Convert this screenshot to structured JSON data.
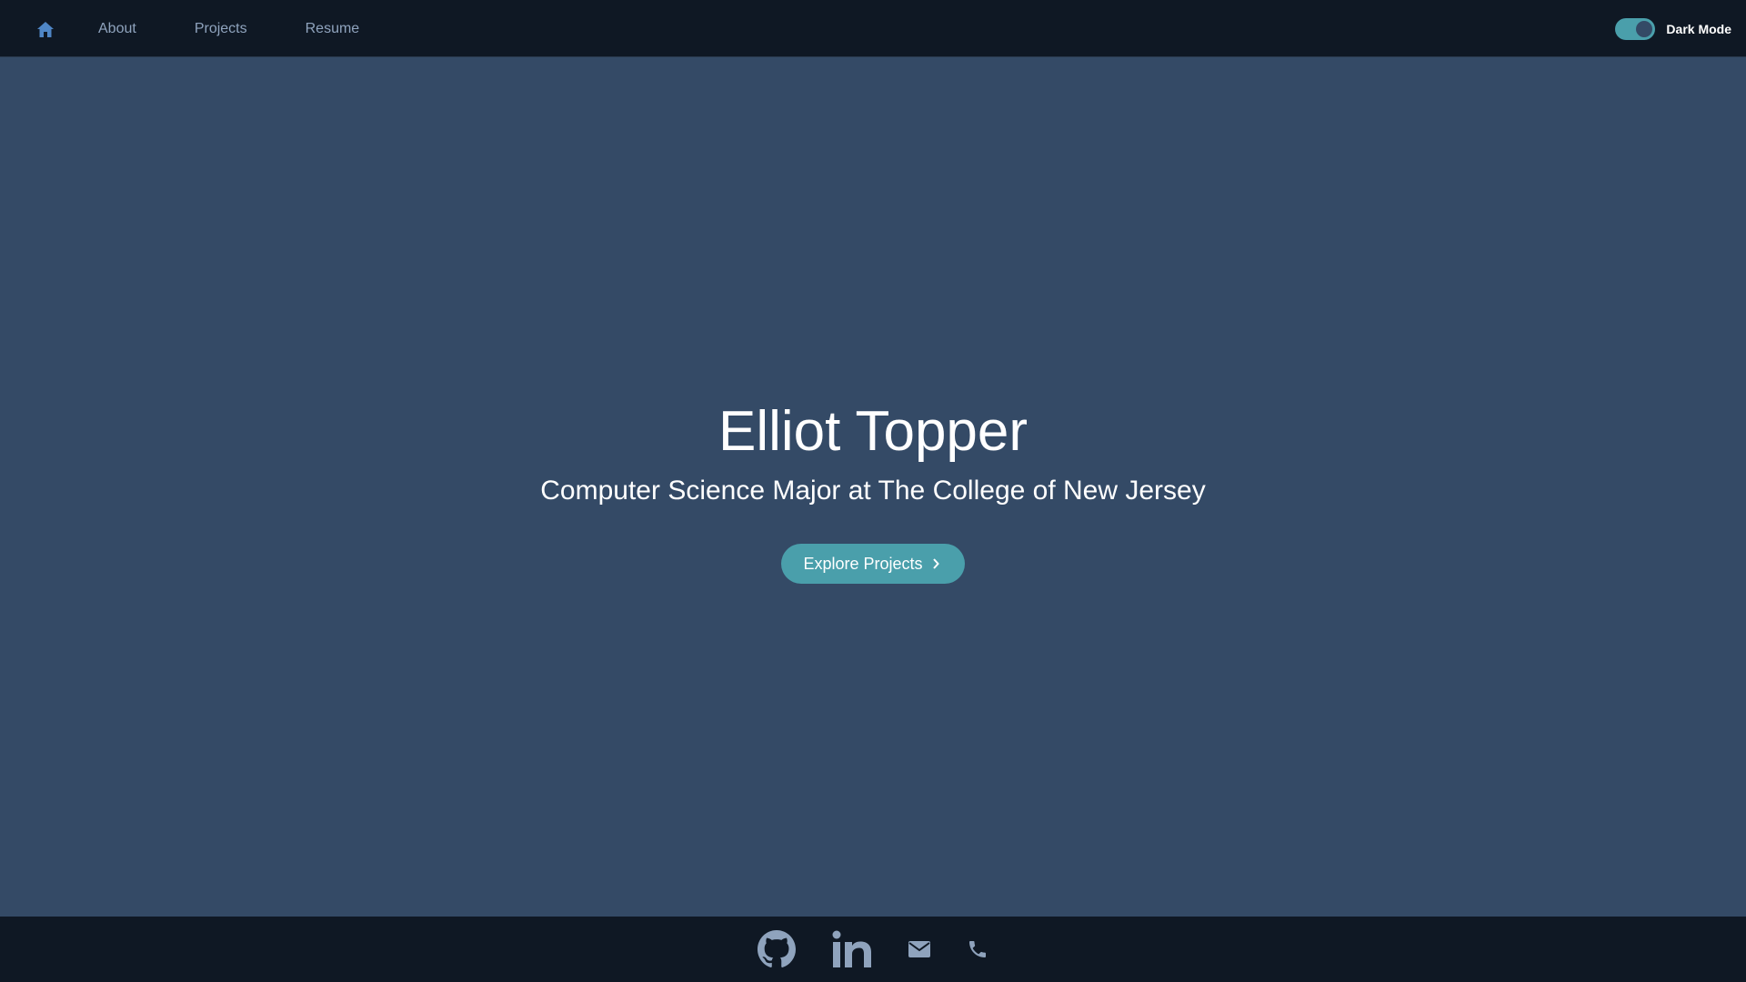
{
  "nav": {
    "home_icon": "home-icon",
    "links": [
      {
        "label": "About"
      },
      {
        "label": "Projects"
      },
      {
        "label": "Resume"
      }
    ]
  },
  "theme_toggle": {
    "label": "Dark Mode",
    "enabled": true
  },
  "hero": {
    "title": "Elliot Topper",
    "subtitle": "Computer Science Major at The College of New Jersey",
    "cta_label": "Explore Projects",
    "cta_icon": "chevron-right-icon"
  },
  "footer": {
    "icons": [
      "github-icon",
      "linkedin-icon",
      "mail-icon",
      "phone-icon"
    ]
  },
  "colors": {
    "background": "#344a66",
    "bars": "#0f1824",
    "accent": "#4a9fab",
    "icon_muted": "#8fa3bd",
    "home_icon": "#4f86c6"
  }
}
